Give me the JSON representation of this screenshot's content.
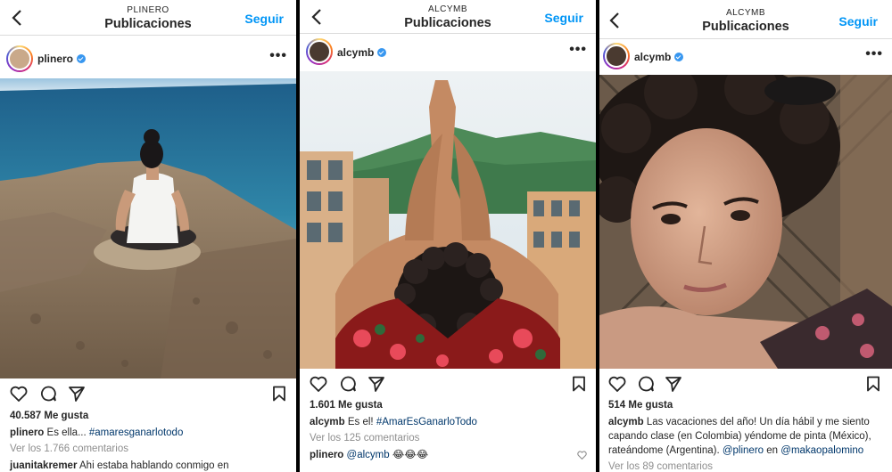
{
  "posts": [
    {
      "header_sub": "PLINERO",
      "header_title": "Publicaciones",
      "follow_label": "Seguir",
      "username": "plinero",
      "likes": "40.587 Me gusta",
      "caption_user": "plinero",
      "caption_text": "Es ella...",
      "caption_tag": "#amaresganarlotodo",
      "view_comments": "Ver los 1.766 comentarios",
      "comment_user": "juanitakremer",
      "comment_text": "Ahi estaba hablando conmigo en"
    },
    {
      "header_sub": "ALCYMB",
      "header_title": "Publicaciones",
      "follow_label": "Seguir",
      "username": "alcymb",
      "likes": "1.601 Me gusta",
      "caption_user": "alcymb",
      "caption_text": "Es el!",
      "caption_tag": "#AmarEsGanarloTodo",
      "view_comments": "Ver los 125 comentarios",
      "comment_user": "plinero",
      "comment_mention": "@alcymb",
      "comment_emoji": "😂😂😂"
    },
    {
      "header_sub": "ALCYMB",
      "header_title": "Publicaciones",
      "follow_label": "Seguir",
      "username": "alcymb",
      "likes": "514 Me gusta",
      "caption_user": "alcymb",
      "caption_text": "Las vacaciones del año! Un día hábil y me siento capando clase (en Colombia) yéndome de pinta (México), rateándome (Argentina).",
      "caption_mention1": "@plinero",
      "caption_mid": "en",
      "caption_mention2": "@makaopalomino",
      "view_comments": "Ver los 89 comentarios"
    }
  ]
}
